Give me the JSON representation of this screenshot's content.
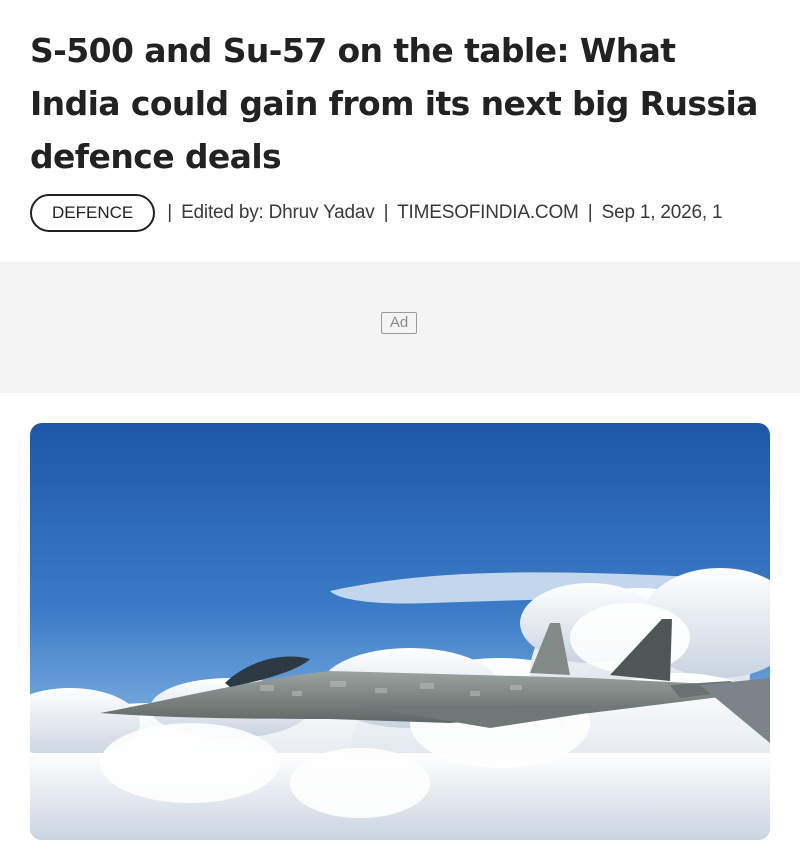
{
  "article": {
    "headline": "S-500 and Su-57 on the table: What India could gain from its next big Russia defence deals",
    "category": "DEFENCE",
    "edited_by": "Edited by: Dhruv Yadav",
    "publisher": "TIMESOFINDIA.COM",
    "timestamp": "Sep 1, 2026, 1",
    "separator": "|"
  },
  "ad": {
    "label": "Ad"
  },
  "hero_image": {
    "subject": "fighter-jet-above-clouds",
    "colors": {
      "sky_top": "#1f5aa8",
      "sky_bottom": "#6fa7dd",
      "cloud": "#f2f4f7",
      "jet": "#7d8683"
    }
  }
}
